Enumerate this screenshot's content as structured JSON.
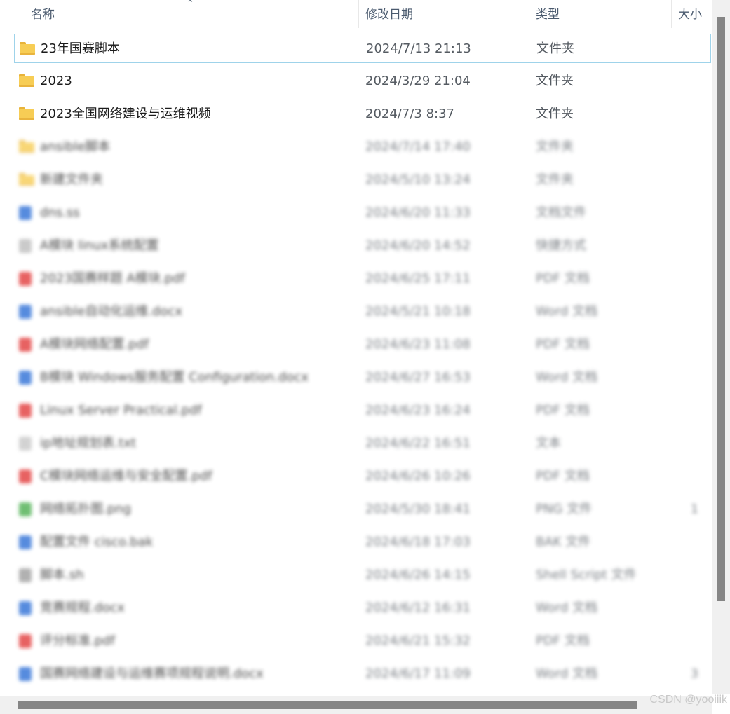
{
  "header": {
    "name_label": "名称",
    "date_label": "修改日期",
    "type_label": "类型",
    "size_label": "大小",
    "sort_icon": "chevron-up-icon"
  },
  "rows": [
    {
      "name": "23年国赛脚本",
      "date": "2024/7/13 21:13",
      "type": "文件夹",
      "size": "",
      "icon": "folder-icon",
      "color": "#f7cd55"
    },
    {
      "name": "2023",
      "date": "2024/3/29 21:04",
      "type": "文件夹",
      "size": "",
      "icon": "folder-icon",
      "color": "#f7cd55"
    },
    {
      "name": "2023全国网络建设与运维视频",
      "date": "2024/7/3 8:37",
      "type": "文件夹",
      "size": "",
      "icon": "folder-icon",
      "color": "#f7cd55"
    }
  ],
  "blurred_rows": [
    {
      "name": "ansible脚本",
      "date": "2024/7/14 17:40",
      "type": "文件夹",
      "size": "",
      "icon": "folder-icon",
      "color": "#f7cd55"
    },
    {
      "name": "新建文件夹",
      "date": "2024/5/10 13:24",
      "type": "文件夹",
      "size": "",
      "icon": "folder-icon",
      "color": "#f7cd55"
    },
    {
      "name": "dns.ss",
      "date": "2024/6/20 11:33",
      "type": "文档文件",
      "size": "",
      "icon": "document-icon",
      "color": "#2d6fd6"
    },
    {
      "name": "A模块 linux系统配置",
      "date": "2024/6/20 14:52",
      "type": "快捷方式",
      "size": "",
      "icon": "shortcut-icon",
      "color": "#bdbdbd"
    },
    {
      "name": "2023国赛样题 A模块.pdf",
      "date": "2024/6/25 17:11",
      "type": "PDF 文档",
      "size": "",
      "icon": "pdf-icon",
      "color": "#e23b3b"
    },
    {
      "name": "ansible自动化运维.docx",
      "date": "2024/5/21 10:18",
      "type": "Word 文档",
      "size": "",
      "icon": "word-icon",
      "color": "#2d6fd6"
    },
    {
      "name": "A模块网络配置.pdf",
      "date": "2024/6/23 11:08",
      "type": "PDF 文档",
      "size": "",
      "icon": "pdf-icon",
      "color": "#e23b3b"
    },
    {
      "name": "B模块 Windows服务配置 Configuration.docx",
      "date": "2024/6/27 16:53",
      "type": "Word 文档",
      "size": "",
      "icon": "word-icon",
      "color": "#2d6fd6"
    },
    {
      "name": "Linux Server Practical.pdf",
      "date": "2024/6/23 16:24",
      "type": "PDF 文档",
      "size": "",
      "icon": "pdf-icon",
      "color": "#e23b3b"
    },
    {
      "name": "ip地址规划表.txt",
      "date": "2024/6/22 16:51",
      "type": "文本",
      "size": "",
      "icon": "text-icon",
      "color": "#c8c8c8"
    },
    {
      "name": "C模块网络运维与安全配置.pdf",
      "date": "2024/6/26 10:26",
      "type": "PDF 文档",
      "size": "",
      "icon": "pdf-icon",
      "color": "#e23b3b"
    },
    {
      "name": "网络拓扑图.png",
      "date": "2024/5/30 18:41",
      "type": "PNG 文件",
      "size": "1",
      "icon": "image-icon",
      "color": "#4caf50"
    },
    {
      "name": "配置文件 cisco.bak",
      "date": "2024/6/18 17:03",
      "type": "BAK 文件",
      "size": "",
      "icon": "file-icon",
      "color": "#2d6fd6"
    },
    {
      "name": "脚本.sh",
      "date": "2024/6/26 14:15",
      "type": "Shell Script 文件",
      "size": "",
      "icon": "script-icon",
      "color": "#9e9e9e"
    },
    {
      "name": "竞赛规程.docx",
      "date": "2024/6/12 16:31",
      "type": "Word 文档",
      "size": "",
      "icon": "word-icon",
      "color": "#2d6fd6"
    },
    {
      "name": "评分标准.pdf",
      "date": "2024/6/21 15:32",
      "type": "PDF 文档",
      "size": "",
      "icon": "pdf-icon",
      "color": "#e23b3b"
    },
    {
      "name": "国赛网络建设与运维赛项规程说明.docx",
      "date": "2024/6/17 11:09",
      "type": "Word 文档",
      "size": "3",
      "icon": "word-icon",
      "color": "#2d6fd6"
    }
  ],
  "watermark": "CSDN @yooiiik"
}
